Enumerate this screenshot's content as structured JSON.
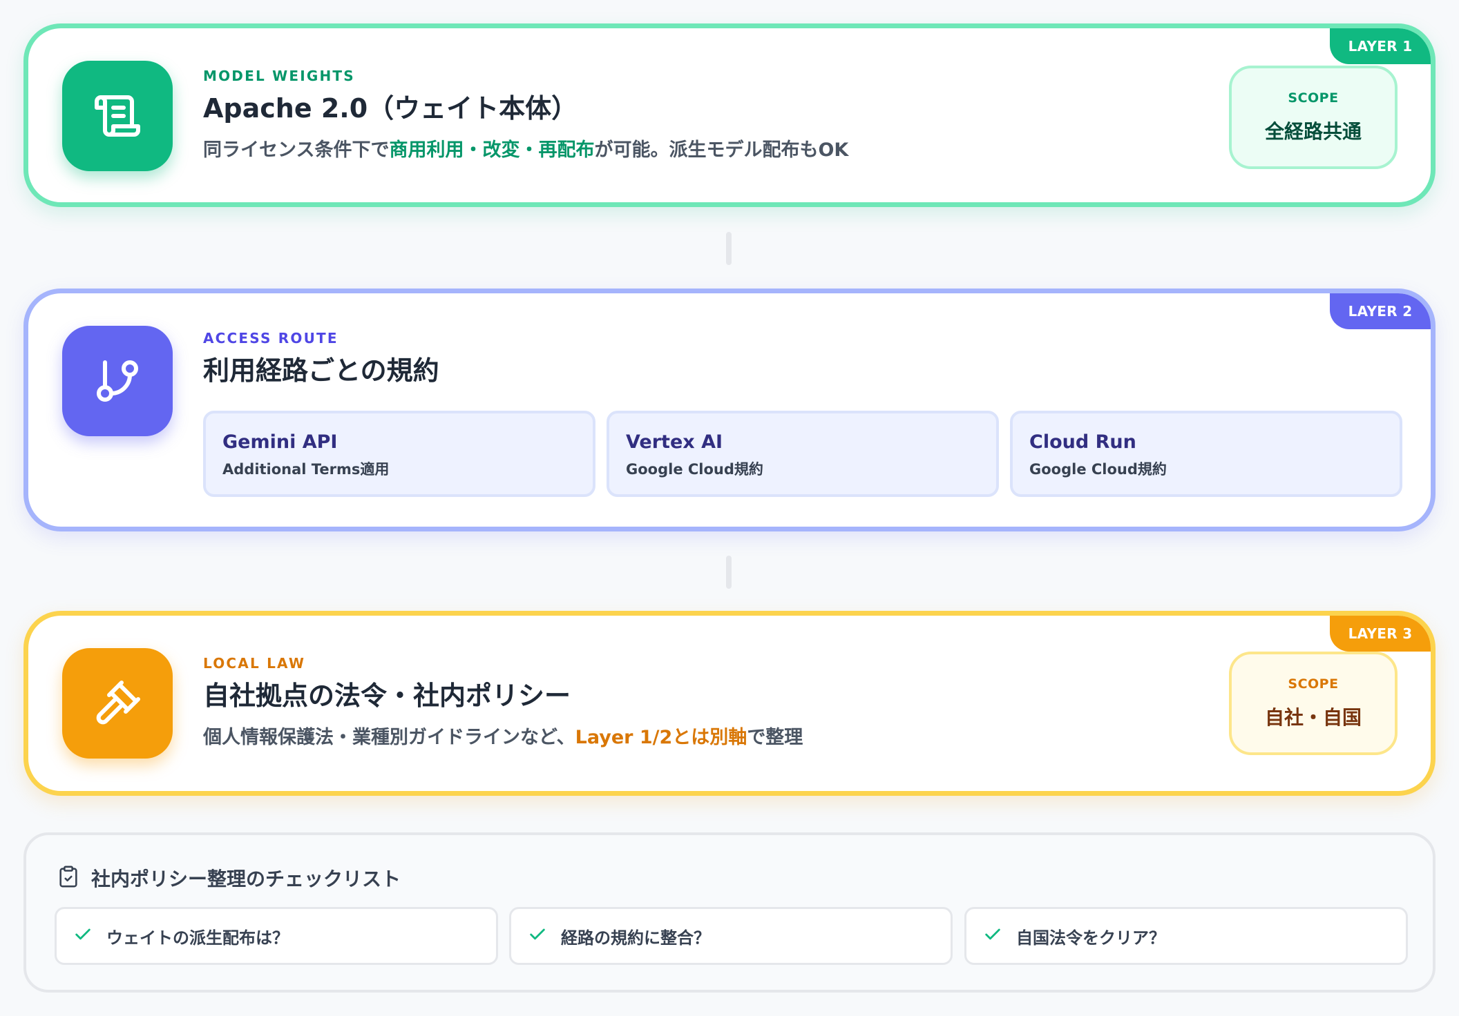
{
  "layer1": {
    "tag": "LAYER 1",
    "icon": "scroll-icon",
    "eyebrow": "MODEL WEIGHTS",
    "title": "Apache 2.0（ウェイト本体）",
    "desc_pre": "同ライセンス条件下で",
    "desc_highlight": "商用利用・改変・再配布",
    "desc_post": "が可能。派生モデル配布もOK",
    "scope_label": "SCOPE",
    "scope_value": "全経路共通"
  },
  "layer2": {
    "tag": "LAYER 2",
    "icon": "git-branch-icon",
    "eyebrow": "ACCESS ROUTE",
    "title": "利用経路ごとの規約",
    "routes": [
      {
        "name": "Gemini API",
        "terms": "Additional Terms適用"
      },
      {
        "name": "Vertex AI",
        "terms": "Google Cloud規約"
      },
      {
        "name": "Cloud Run",
        "terms": "Google Cloud規約"
      }
    ]
  },
  "layer3": {
    "tag": "LAYER 3",
    "icon": "gavel-icon",
    "eyebrow": "LOCAL LAW",
    "title": "自社拠点の法令・社内ポリシー",
    "desc_pre": "個人情報保護法・業種別ガイドラインなど、",
    "desc_highlight": "Layer 1/2とは別軸",
    "desc_post": "で整理",
    "scope_label": "SCOPE",
    "scope_value": "自社・自国"
  },
  "checklist": {
    "icon": "clipboard-check-icon",
    "title": "社内ポリシー整理のチェックリスト",
    "items": [
      {
        "icon": "check-icon",
        "text": "ウェイトの派生配布は？"
      },
      {
        "icon": "check-icon",
        "text": "経路の規約に整合？"
      },
      {
        "icon": "check-icon",
        "text": "自国法令をクリア？"
      }
    ]
  },
  "colors": {
    "green": "#10b981",
    "indigo": "#6366f1",
    "amber": "#f59e0b"
  }
}
